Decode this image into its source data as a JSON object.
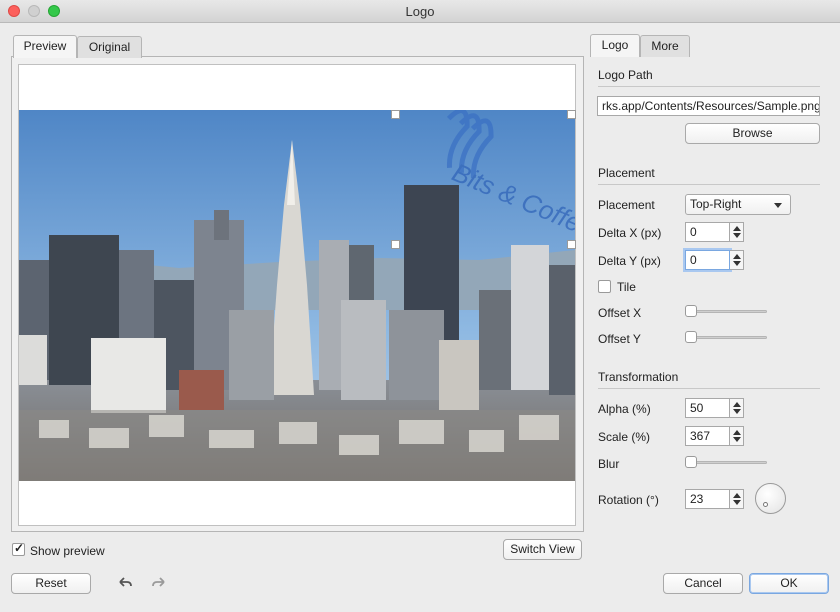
{
  "window": {
    "title": "Logo"
  },
  "left_tabs": [
    {
      "label": "Preview"
    },
    {
      "label": "Original"
    }
  ],
  "right_tabs": [
    {
      "label": "Logo"
    },
    {
      "label": "More"
    }
  ],
  "preview": {
    "logo_text": "Bits & Coffee"
  },
  "logo_path": {
    "section": "Logo Path",
    "value": "rks.app/Contents/Resources/Sample.png",
    "browse_label": "Browse"
  },
  "placement": {
    "section": "Placement",
    "placement_label": "Placement",
    "placement_value": "Top-Right",
    "delta_x_label": "Delta X (px)",
    "delta_x_value": "0",
    "delta_y_label": "Delta Y (px)",
    "delta_y_value": "0",
    "tile_label": "Tile",
    "offset_x_label": "Offset X",
    "offset_y_label": "Offset Y"
  },
  "transformation": {
    "section": "Transformation",
    "alpha_label": "Alpha (%)",
    "alpha_value": "50",
    "scale_label": "Scale (%)",
    "scale_value": "367",
    "blur_label": "Blur",
    "rotation_label": "Rotation (°)",
    "rotation_value": "23"
  },
  "bottom": {
    "show_preview_label": "Show preview",
    "switch_view_label": "Switch View",
    "reset_label": "Reset",
    "cancel_label": "Cancel",
    "ok_label": "OK"
  },
  "icons": {
    "undo": "undo-arrow-icon",
    "redo": "redo-arrow-icon"
  },
  "colors": {
    "sky": "#6d9fd3",
    "accent": "#7aa7e0"
  }
}
